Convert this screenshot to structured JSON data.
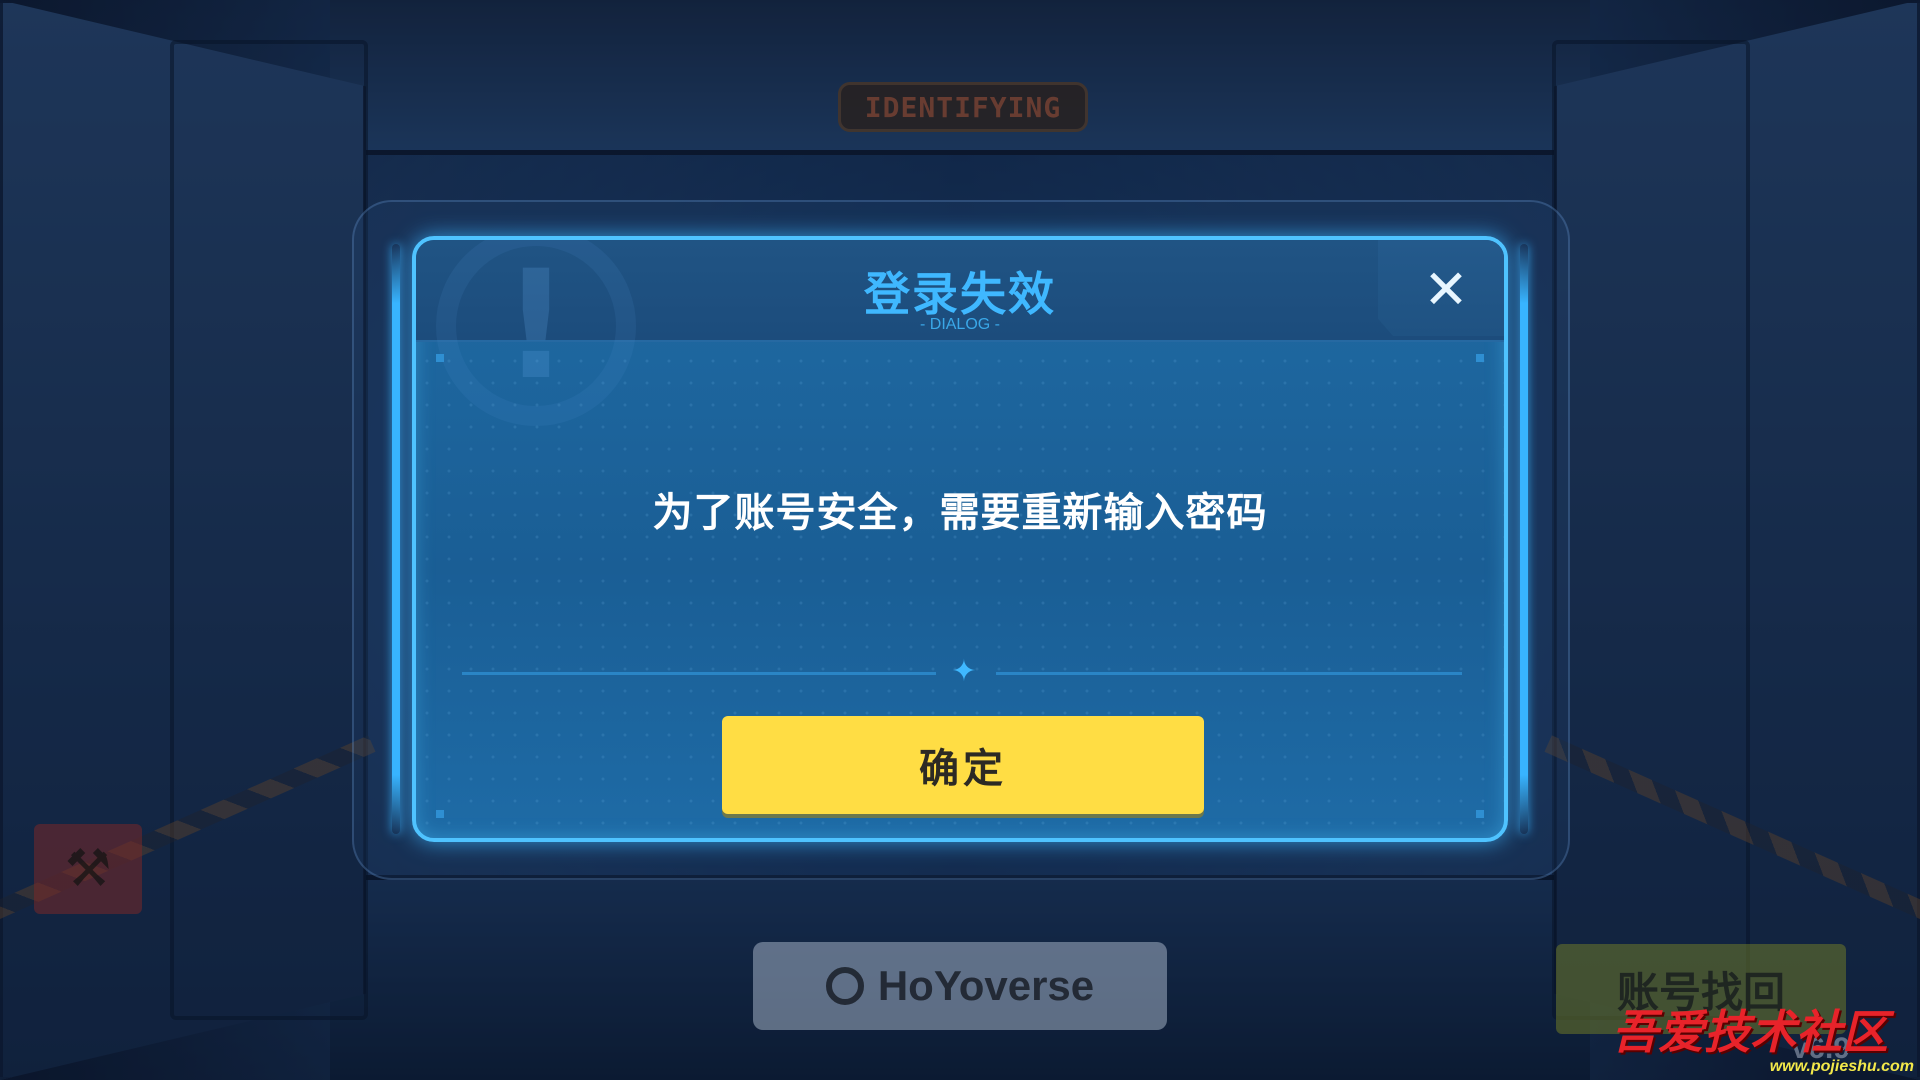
{
  "background": {
    "sign_text": "IDENTIFYING",
    "tool_icon": "wrench-hammer-icon",
    "hoyoverse_label": "HoYoverse",
    "recover_label": "账号找回",
    "version_text": "v6.9"
  },
  "dialog": {
    "title": "登录失效",
    "subtitle": "- DIALOG -",
    "close_icon": "close-icon",
    "message": "为了账号安全，需要重新输入密码",
    "confirm_label": "确定",
    "accent_color": "#3fb8ff",
    "confirm_color": "#ffdd44"
  },
  "watermark": {
    "text": "吾爱技术社区",
    "url": "www.pojieshu.com"
  }
}
